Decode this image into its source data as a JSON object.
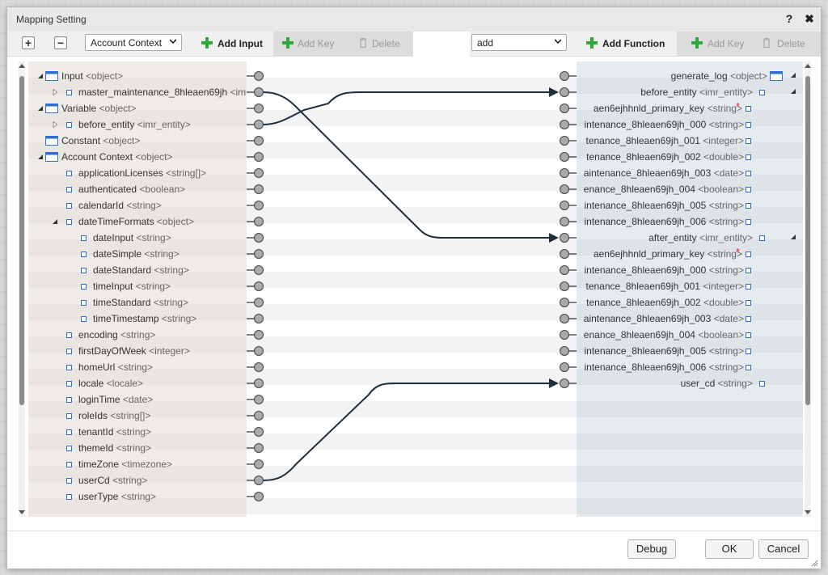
{
  "dialog": {
    "title": "Mapping Setting",
    "help_label": "?",
    "close_label": "✖"
  },
  "left_toolbar": {
    "expand_label": "+",
    "collapse_label": "−",
    "context_select": "Account Context",
    "add_input_label": "Add Input",
    "add_key_label": "Add Key",
    "delete_label": "Delete"
  },
  "right_toolbar": {
    "function_select": "add",
    "add_function_label": "Add Function",
    "add_key_label": "Add Key",
    "delete_label": "Delete"
  },
  "left_tree": [
    {
      "indent": 0,
      "toggle": "expanded",
      "icon": "object",
      "name": "Input",
      "type": "<object>"
    },
    {
      "indent": 1,
      "toggle": "collapsed",
      "icon": "field",
      "name": "master_maintenance_8hleaen69jh",
      "type": "<im"
    },
    {
      "indent": 0,
      "toggle": "expanded",
      "icon": "object",
      "name": "Variable",
      "type": "<object>"
    },
    {
      "indent": 1,
      "toggle": "collapsed",
      "icon": "field",
      "name": "before_entity",
      "type": "<imr_entity>"
    },
    {
      "indent": 0,
      "toggle": "none",
      "icon": "object",
      "name": "Constant",
      "type": "<object>"
    },
    {
      "indent": 0,
      "toggle": "expanded",
      "icon": "object",
      "name": "Account Context",
      "type": "<object>"
    },
    {
      "indent": 1,
      "toggle": "none",
      "icon": "field",
      "name": "applicationLicenses",
      "type": "<string[]>"
    },
    {
      "indent": 1,
      "toggle": "none",
      "icon": "field",
      "name": "authenticated",
      "type": "<boolean>"
    },
    {
      "indent": 1,
      "toggle": "none",
      "icon": "field",
      "name": "calendarId",
      "type": "<string>"
    },
    {
      "indent": 1,
      "toggle": "expanded",
      "icon": "field",
      "name": "dateTimeFormats",
      "type": "<object>"
    },
    {
      "indent": 2,
      "toggle": "none",
      "icon": "field",
      "name": "dateInput",
      "type": "<string>"
    },
    {
      "indent": 2,
      "toggle": "none",
      "icon": "field",
      "name": "dateSimple",
      "type": "<string>"
    },
    {
      "indent": 2,
      "toggle": "none",
      "icon": "field",
      "name": "dateStandard",
      "type": "<string>"
    },
    {
      "indent": 2,
      "toggle": "none",
      "icon": "field",
      "name": "timeInput",
      "type": "<string>"
    },
    {
      "indent": 2,
      "toggle": "none",
      "icon": "field",
      "name": "timeStandard",
      "type": "<string>"
    },
    {
      "indent": 2,
      "toggle": "none",
      "icon": "field",
      "name": "timeTimestamp",
      "type": "<string>"
    },
    {
      "indent": 1,
      "toggle": "none",
      "icon": "field",
      "name": "encoding",
      "type": "<string>"
    },
    {
      "indent": 1,
      "toggle": "none",
      "icon": "field",
      "name": "firstDayOfWeek",
      "type": "<integer>"
    },
    {
      "indent": 1,
      "toggle": "none",
      "icon": "field",
      "name": "homeUrl",
      "type": "<string>"
    },
    {
      "indent": 1,
      "toggle": "none",
      "icon": "field",
      "name": "locale",
      "type": "<locale>"
    },
    {
      "indent": 1,
      "toggle": "none",
      "icon": "field",
      "name": "loginTime",
      "type": "<date>"
    },
    {
      "indent": 1,
      "toggle": "none",
      "icon": "field",
      "name": "roleIds",
      "type": "<string[]>"
    },
    {
      "indent": 1,
      "toggle": "none",
      "icon": "field",
      "name": "tenantId",
      "type": "<string>"
    },
    {
      "indent": 1,
      "toggle": "none",
      "icon": "field",
      "name": "themeId",
      "type": "<string>"
    },
    {
      "indent": 1,
      "toggle": "none",
      "icon": "field",
      "name": "timeZone",
      "type": "<timezone>"
    },
    {
      "indent": 1,
      "toggle": "none",
      "icon": "field",
      "name": "userCd",
      "type": "<string>"
    },
    {
      "indent": 1,
      "toggle": "none",
      "icon": "field",
      "name": "userType",
      "type": "<string>"
    }
  ],
  "right_tree": [
    {
      "name": "generate_log",
      "type": "<object>",
      "icon": "object",
      "toggle": "expanded",
      "required": false
    },
    {
      "name": "before_entity",
      "type": "<imr_entity>",
      "icon": "field",
      "toggle": "expanded",
      "required": false
    },
    {
      "name": "aen6ejhhnld_primary_key",
      "type": "<string>",
      "icon": "field",
      "toggle": "none",
      "required": true
    },
    {
      "name": "intenance_8hleaen69jh_000",
      "type": "<string>",
      "icon": "field",
      "toggle": "none",
      "required": false
    },
    {
      "name": "tenance_8hleaen69jh_001",
      "type": "<integer>",
      "icon": "field",
      "toggle": "none",
      "required": false
    },
    {
      "name": "tenance_8hleaen69jh_002",
      "type": "<double>",
      "icon": "field",
      "toggle": "none",
      "required": false
    },
    {
      "name": "aintenance_8hleaen69jh_003",
      "type": "<date>",
      "icon": "field",
      "toggle": "none",
      "required": false
    },
    {
      "name": "enance_8hleaen69jh_004",
      "type": "<boolean>",
      "icon": "field",
      "toggle": "none",
      "required": false
    },
    {
      "name": "intenance_8hleaen69jh_005",
      "type": "<string>",
      "icon": "field",
      "toggle": "none",
      "required": false
    },
    {
      "name": "intenance_8hleaen69jh_006",
      "type": "<string>",
      "icon": "field",
      "toggle": "none",
      "required": false
    },
    {
      "name": "after_entity",
      "type": "<imr_entity>",
      "icon": "field",
      "toggle": "expanded",
      "required": false
    },
    {
      "name": "aen6ejhhnld_primary_key",
      "type": "<string>",
      "icon": "field",
      "toggle": "none",
      "required": true
    },
    {
      "name": "intenance_8hleaen69jh_000",
      "type": "<string>",
      "icon": "field",
      "toggle": "none",
      "required": false
    },
    {
      "name": "tenance_8hleaen69jh_001",
      "type": "<integer>",
      "icon": "field",
      "toggle": "none",
      "required": false
    },
    {
      "name": "tenance_8hleaen69jh_002",
      "type": "<double>",
      "icon": "field",
      "toggle": "none",
      "required": false
    },
    {
      "name": "aintenance_8hleaen69jh_003",
      "type": "<date>",
      "icon": "field",
      "toggle": "none",
      "required": false
    },
    {
      "name": "enance_8hleaen69jh_004",
      "type": "<boolean>",
      "icon": "field",
      "toggle": "none",
      "required": false
    },
    {
      "name": "intenance_8hleaen69jh_005",
      "type": "<string>",
      "icon": "field",
      "toggle": "none",
      "required": false
    },
    {
      "name": "intenance_8hleaen69jh_006",
      "type": "<string>",
      "icon": "field",
      "toggle": "none",
      "required": false
    },
    {
      "name": "user_cd",
      "type": "<string>",
      "icon": "field",
      "toggle": "none",
      "required": false
    }
  ],
  "connections": [
    {
      "from": 1,
      "to": 10
    },
    {
      "from": 3,
      "to": 1
    },
    {
      "from": 25,
      "to": 19
    }
  ],
  "footer": {
    "debug_label": "Debug",
    "ok_label": "OK",
    "cancel_label": "Cancel"
  },
  "colors": {
    "wire": "#1f2f3f",
    "required": "#d9262c",
    "icon_blue": "#2e6fd1",
    "plus_green": "#2eaa3a"
  }
}
